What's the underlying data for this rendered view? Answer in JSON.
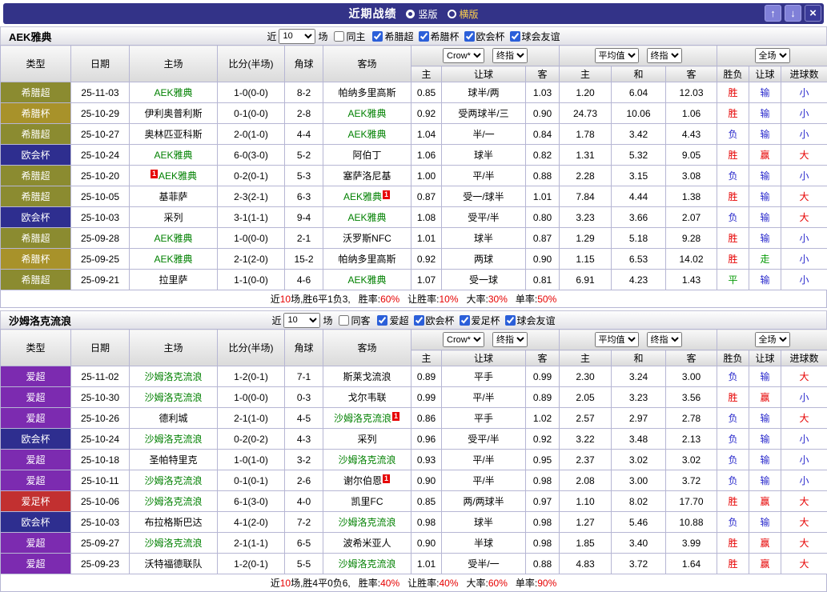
{
  "palette": {
    "league": {
      "希腊超": "#8b8b30",
      "希腊杯": "#a8922a",
      "欧会杯": "#2e2e8f",
      "爱超": "#7c2bb0",
      "爱足杯": "#c23030"
    },
    "result": {
      "胜": "#e60000",
      "平": "#089b08",
      "负": "#2929cc",
      "赢": "#e60000",
      "走": "#089b08",
      "输": "#2929cc",
      "大": "#e60000",
      "小": "#2929cc"
    },
    "team_highlight": "#008000",
    "accent_red": "#e60000",
    "titlebar_bg": "#333388"
  },
  "titlebar": {
    "title": "近期战绩",
    "layout_options": [
      {
        "label": "竖版",
        "selected": true
      },
      {
        "label": "横版",
        "selected": false
      }
    ],
    "up_icon": "↑",
    "down_icon": "↓",
    "close_icon": "×"
  },
  "table_header": {
    "type": "类型",
    "date": "日期",
    "home": "主场",
    "score": "比分(半场)",
    "corner": "角球",
    "away": "客场",
    "book_select": "Crow*",
    "final_select": "终指",
    "avg_select": "平均值",
    "final_select2": "终指",
    "scope_select": "全场",
    "sub": [
      "主",
      "让球",
      "客",
      "主",
      "和",
      "客",
      "胜负",
      "让球",
      "进球数"
    ]
  },
  "sections": [
    {
      "team": "AEK雅典",
      "filter": {
        "near": "近",
        "count": "10",
        "games": "场",
        "same": {
          "label": "同主",
          "checked": false
        },
        "leagues": [
          {
            "label": "希腊超",
            "checked": true
          },
          {
            "label": "希腊杯",
            "checked": true
          },
          {
            "label": "欧会杯",
            "checked": true
          },
          {
            "label": "球会友谊",
            "checked": true
          }
        ]
      },
      "rows": [
        {
          "league": "希腊超",
          "date": "25-11-03",
          "home": {
            "name": "AEK雅典",
            "highlight": true
          },
          "score": "1-0(0-0)",
          "corner": "8-2",
          "away": {
            "name": "帕纳多里高斯"
          },
          "odds": [
            "0.85",
            "球半/两",
            "1.03"
          ],
          "avg": [
            "1.20",
            "6.04",
            "12.03"
          ],
          "results": [
            "胜",
            "输",
            "小"
          ]
        },
        {
          "league": "希腊杯",
          "date": "25-10-29",
          "home": {
            "name": "伊利奥普利斯"
          },
          "score": "0-1(0-0)",
          "corner": "2-8",
          "away": {
            "name": "AEK雅典",
            "highlight": true
          },
          "odds": [
            "0.92",
            "受两球半/三",
            "0.90"
          ],
          "avg": [
            "24.73",
            "10.06",
            "1.06"
          ],
          "results": [
            "胜",
            "输",
            "小"
          ]
        },
        {
          "league": "希腊超",
          "date": "25-10-27",
          "home": {
            "name": "奥林匹亚科斯"
          },
          "score": "2-0(1-0)",
          "corner": "4-4",
          "away": {
            "name": "AEK雅典",
            "highlight": true
          },
          "odds": [
            "1.04",
            "半/一",
            "0.84"
          ],
          "avg": [
            "1.78",
            "3.42",
            "4.43"
          ],
          "results": [
            "负",
            "输",
            "小"
          ]
        },
        {
          "league": "欧会杯",
          "date": "25-10-24",
          "home": {
            "name": "AEK雅典",
            "highlight": true
          },
          "score": "6-0(3-0)",
          "corner": "5-2",
          "away": {
            "name": "阿伯丁"
          },
          "odds": [
            "1.06",
            "球半",
            "0.82"
          ],
          "avg": [
            "1.31",
            "5.32",
            "9.05"
          ],
          "results": [
            "胜",
            "赢",
            "大"
          ]
        },
        {
          "league": "希腊超",
          "date": "25-10-20",
          "home": {
            "name": "AEK雅典",
            "highlight": true,
            "card": "pre"
          },
          "score": "0-2(0-1)",
          "corner": "5-3",
          "away": {
            "name": "塞萨洛尼基"
          },
          "odds": [
            "1.00",
            "平/半",
            "0.88"
          ],
          "avg": [
            "2.28",
            "3.15",
            "3.08"
          ],
          "results": [
            "负",
            "输",
            "小"
          ]
        },
        {
          "league": "希腊超",
          "date": "25-10-05",
          "home": {
            "name": "基菲萨"
          },
          "score": "2-3(2-1)",
          "corner": "6-3",
          "away": {
            "name": "AEK雅典",
            "highlight": true,
            "card": "post"
          },
          "odds": [
            "0.87",
            "受一/球半",
            "1.01"
          ],
          "avg": [
            "7.84",
            "4.44",
            "1.38"
          ],
          "results": [
            "胜",
            "输",
            "大"
          ]
        },
        {
          "league": "欧会杯",
          "date": "25-10-03",
          "home": {
            "name": "采列"
          },
          "score": "3-1(1-1)",
          "corner": "9-4",
          "away": {
            "name": "AEK雅典",
            "highlight": true
          },
          "odds": [
            "1.08",
            "受平/半",
            "0.80"
          ],
          "avg": [
            "3.23",
            "3.66",
            "2.07"
          ],
          "results": [
            "负",
            "输",
            "大"
          ]
        },
        {
          "league": "希腊超",
          "date": "25-09-28",
          "home": {
            "name": "AEK雅典",
            "highlight": true
          },
          "score": "1-0(0-0)",
          "corner": "2-1",
          "away": {
            "name": "沃罗斯NFC"
          },
          "odds": [
            "1.01",
            "球半",
            "0.87"
          ],
          "avg": [
            "1.29",
            "5.18",
            "9.28"
          ],
          "results": [
            "胜",
            "输",
            "小"
          ]
        },
        {
          "league": "希腊杯",
          "date": "25-09-25",
          "home": {
            "name": "AEK雅典",
            "highlight": true
          },
          "score": "2-1(2-0)",
          "corner": "15-2",
          "away": {
            "name": "帕纳多里高斯"
          },
          "odds": [
            "0.92",
            "两球",
            "0.90"
          ],
          "avg": [
            "1.15",
            "6.53",
            "14.02"
          ],
          "results": [
            "胜",
            "走",
            "小"
          ]
        },
        {
          "league": "希腊超",
          "date": "25-09-21",
          "home": {
            "name": "拉里萨"
          },
          "score": "1-1(0-0)",
          "corner": "4-6",
          "away": {
            "name": "AEK雅典",
            "highlight": true
          },
          "odds": [
            "1.07",
            "受一球",
            "0.81"
          ],
          "avg": [
            "6.91",
            "4.23",
            "1.43"
          ],
          "results": [
            "平",
            "输",
            "小"
          ]
        }
      ],
      "summary": {
        "prefix": "近",
        "count": "10",
        "middle": "场,胜6平1负3,",
        "stats": [
          {
            "label": "胜率:",
            "value": "60%"
          },
          {
            "label": "让胜率:",
            "value": "10%"
          },
          {
            "label": "大率:",
            "value": "30%"
          },
          {
            "label": "单率:",
            "value": "50%"
          }
        ]
      }
    },
    {
      "team": "沙姆洛克流浪",
      "filter": {
        "near": "近",
        "count": "10",
        "games": "场",
        "same": {
          "label": "同客",
          "checked": false
        },
        "leagues": [
          {
            "label": "爱超",
            "checked": true
          },
          {
            "label": "欧会杯",
            "checked": true
          },
          {
            "label": "爱足杯",
            "checked": true
          },
          {
            "label": "球会友谊",
            "checked": true
          }
        ]
      },
      "rows": [
        {
          "league": "爱超",
          "date": "25-11-02",
          "home": {
            "name": "沙姆洛克流浪",
            "highlight": true
          },
          "score": "1-2(0-1)",
          "corner": "7-1",
          "away": {
            "name": "斯莱戈流浪"
          },
          "odds": [
            "0.89",
            "平手",
            "0.99"
          ],
          "avg": [
            "2.30",
            "3.24",
            "3.00"
          ],
          "results": [
            "负",
            "输",
            "大"
          ]
        },
        {
          "league": "爱超",
          "date": "25-10-30",
          "home": {
            "name": "沙姆洛克流浪",
            "highlight": true
          },
          "score": "1-0(0-0)",
          "corner": "0-3",
          "away": {
            "name": "戈尔韦联"
          },
          "odds": [
            "0.99",
            "平/半",
            "0.89"
          ],
          "avg": [
            "2.05",
            "3.23",
            "3.56"
          ],
          "results": [
            "胜",
            "赢",
            "小"
          ]
        },
        {
          "league": "爱超",
          "date": "25-10-26",
          "home": {
            "name": "德利城"
          },
          "score": "2-1(1-0)",
          "corner": "4-5",
          "away": {
            "name": "沙姆洛克流浪",
            "highlight": true,
            "card": "post"
          },
          "odds": [
            "0.86",
            "平手",
            "1.02"
          ],
          "avg": [
            "2.57",
            "2.97",
            "2.78"
          ],
          "results": [
            "负",
            "输",
            "大"
          ]
        },
        {
          "league": "欧会杯",
          "date": "25-10-24",
          "home": {
            "name": "沙姆洛克流浪",
            "highlight": true
          },
          "score": "0-2(0-2)",
          "corner": "4-3",
          "away": {
            "name": "采列"
          },
          "odds": [
            "0.96",
            "受平/半",
            "0.92"
          ],
          "avg": [
            "3.22",
            "3.48",
            "2.13"
          ],
          "results": [
            "负",
            "输",
            "小"
          ]
        },
        {
          "league": "爱超",
          "date": "25-10-18",
          "home": {
            "name": "圣帕特里克"
          },
          "score": "1-0(1-0)",
          "corner": "3-2",
          "away": {
            "name": "沙姆洛克流浪",
            "highlight": true
          },
          "odds": [
            "0.93",
            "平/半",
            "0.95"
          ],
          "avg": [
            "2.37",
            "3.02",
            "3.02"
          ],
          "results": [
            "负",
            "输",
            "小"
          ]
        },
        {
          "league": "爱超",
          "date": "25-10-11",
          "home": {
            "name": "沙姆洛克流浪",
            "highlight": true
          },
          "score": "0-1(0-1)",
          "corner": "2-6",
          "away": {
            "name": "谢尔伯恩",
            "card": "post"
          },
          "odds": [
            "0.90",
            "平/半",
            "0.98"
          ],
          "avg": [
            "2.08",
            "3.00",
            "3.72"
          ],
          "results": [
            "负",
            "输",
            "小"
          ]
        },
        {
          "league": "爱足杯",
          "date": "25-10-06",
          "home": {
            "name": "沙姆洛克流浪",
            "highlight": true
          },
          "score": "6-1(3-0)",
          "corner": "4-0",
          "away": {
            "name": "凯里FC"
          },
          "odds": [
            "0.85",
            "两/两球半",
            "0.97"
          ],
          "avg": [
            "1.10",
            "8.02",
            "17.70"
          ],
          "results": [
            "胜",
            "赢",
            "大"
          ]
        },
        {
          "league": "欧会杯",
          "date": "25-10-03",
          "home": {
            "name": "布拉格斯巴达"
          },
          "score": "4-1(2-0)",
          "corner": "7-2",
          "away": {
            "name": "沙姆洛克流浪",
            "highlight": true
          },
          "odds": [
            "0.98",
            "球半",
            "0.98"
          ],
          "avg": [
            "1.27",
            "5.46",
            "10.88"
          ],
          "results": [
            "负",
            "输",
            "大"
          ]
        },
        {
          "league": "爱超",
          "date": "25-09-27",
          "home": {
            "name": "沙姆洛克流浪",
            "highlight": true
          },
          "score": "2-1(1-1)",
          "corner": "6-5",
          "away": {
            "name": "波希米亚人"
          },
          "odds": [
            "0.90",
            "半球",
            "0.98"
          ],
          "avg": [
            "1.85",
            "3.40",
            "3.99"
          ],
          "results": [
            "胜",
            "赢",
            "大"
          ]
        },
        {
          "league": "爱超",
          "date": "25-09-23",
          "home": {
            "name": "沃特福德联队"
          },
          "score": "1-2(0-1)",
          "corner": "5-5",
          "away": {
            "name": "沙姆洛克流浪",
            "highlight": true
          },
          "odds": [
            "1.01",
            "受半/一",
            "0.88"
          ],
          "avg": [
            "4.83",
            "3.72",
            "1.64"
          ],
          "results": [
            "胜",
            "赢",
            "大"
          ]
        }
      ],
      "summary": {
        "prefix": "近",
        "count": "10",
        "middle": "场,胜4平0负6,",
        "stats": [
          {
            "label": "胜率:",
            "value": "40%"
          },
          {
            "label": "让胜率:",
            "value": "40%"
          },
          {
            "label": "大率:",
            "value": "60%"
          },
          {
            "label": "单率:",
            "value": "90%"
          }
        ]
      }
    }
  ]
}
